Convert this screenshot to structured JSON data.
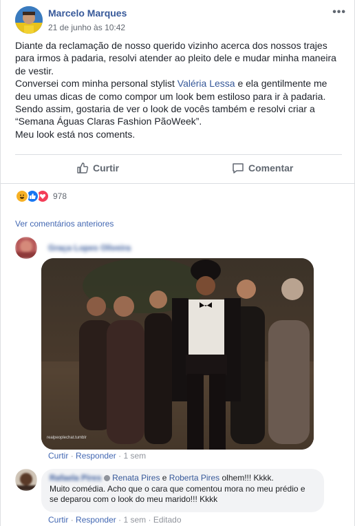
{
  "post": {
    "author": "Marcelo Marques",
    "timestamp": "21 de junho às 10:42",
    "paragraph1": "Diante da reclamação de nosso querido vizinho acerca dos nossos trajes para irmos à padaria, resolvi atender ao pleito dele e mudar minha maneira de vestir.",
    "paragraph2_start": "Conversei com minha personal stylist ",
    "paragraph2_link": "Valéria Lessa",
    "paragraph2_end": " e ela gentilmente me deu umas dicas de como compor um look bem estiloso para ir à padaria. Sendo assim, gostaria de ver o look de vocês também e resolvi criar a “Semana Águas Claras Fashion PãoWeek”.",
    "paragraph3": "Meu look está nos coments."
  },
  "actions": {
    "like": "Curtir",
    "comment": "Comentar"
  },
  "reactions": {
    "count": "978",
    "icons": [
      "haha-icon",
      "like-icon",
      "love-icon"
    ]
  },
  "comments_section": {
    "view_previous": "Ver comentários anteriores"
  },
  "comment1": {
    "author_blurred": "Graça Lopes Oliveira",
    "gif_watermark": "realpeoplechat.tumblr",
    "like": "Curtir",
    "reply": "Responder",
    "dot": "·",
    "time": "1 sem"
  },
  "comment2": {
    "author_blurred": "Rafaela Pires",
    "tag1": "Renata Pires",
    "and": " e ",
    "tag2": "Roberta Pires",
    "text_inline": " olhem!!! Kkkk.",
    "text_rest": "Muito comédia. Acho que o cara que comentou mora no meu prédio e se deparou com o look do meu marido!!! Kkkk",
    "like": "Curtir",
    "reply": "Responder",
    "dot": "·",
    "time": "1 sem",
    "edited": "Editado"
  },
  "colors": {
    "link": "#365899",
    "action": "#4267b2",
    "like_blue": "#1877f2",
    "love_red": "#f33e58",
    "haha_yellow": "#f7b125"
  }
}
